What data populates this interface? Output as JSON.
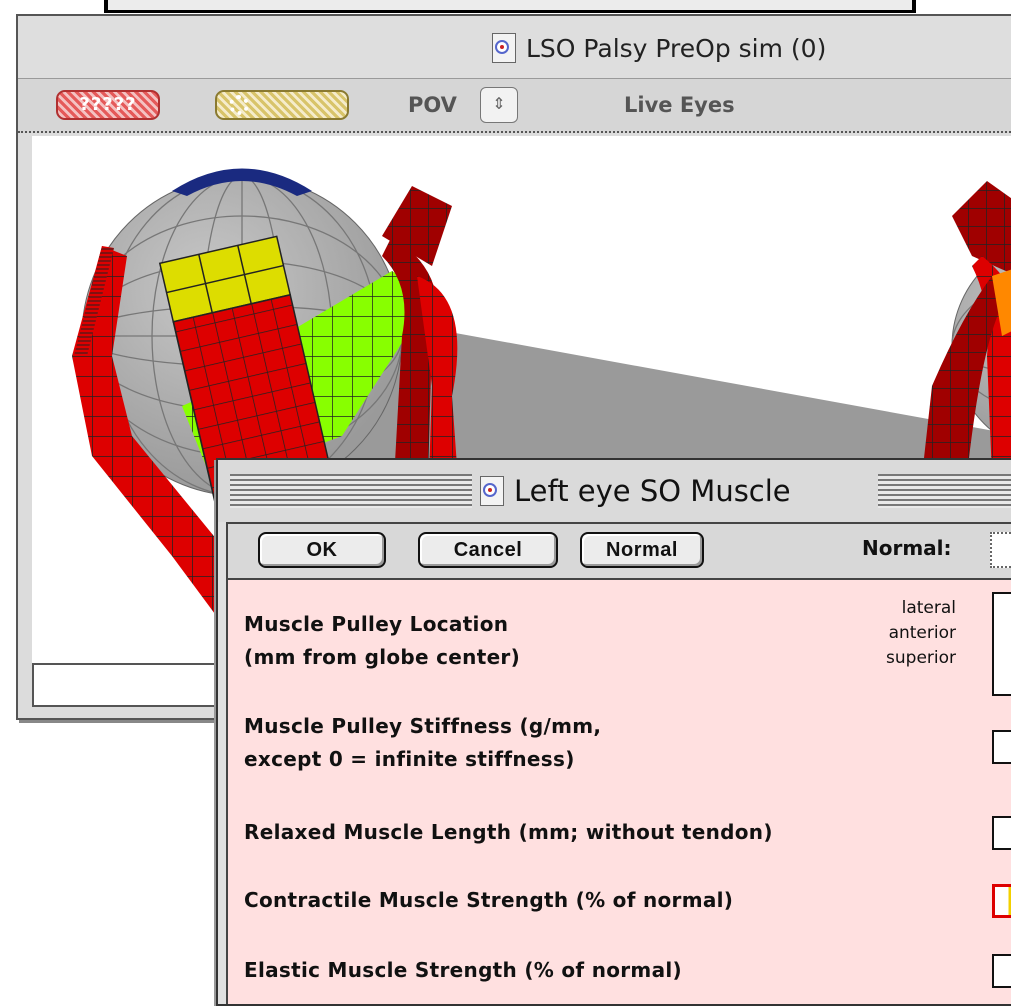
{
  "main_window": {
    "title": "LSO Palsy PreOp sim (0)",
    "toolbar": {
      "pov_label": "POV",
      "pov_stepper_symbol": "⇕",
      "live_eyes_label": "Live Eyes"
    }
  },
  "dialog": {
    "title": "Left eye  SO Muscle",
    "buttons": {
      "ok": "OK",
      "cancel": "Cancel",
      "normal": "Normal"
    },
    "normal_field_label": "Normal:",
    "params": {
      "pulley_location": {
        "line1": "Muscle Pulley Location",
        "line2": "(mm from globe center)",
        "axes": [
          "lateral",
          "anterior",
          "superior"
        ]
      },
      "pulley_stiffness": {
        "line1": "Muscle Pulley Stiffness (g/mm,",
        "line2": "except 0 = infinite stiffness)"
      },
      "relaxed_length": "Relaxed Muscle Length (mm; without tendon)",
      "contractile_strength": "Contractile Muscle Strength (% of normal)",
      "elastic_strength": "Elastic Muscle Strength (% of normal)"
    }
  },
  "colors": {
    "muscle_red": "#dd0000",
    "muscle_green": "#88ff00",
    "muscle_yellow": "#dddd00",
    "globe_grey": "#b0b0b0",
    "dialog_body": "#ffe0e0"
  }
}
